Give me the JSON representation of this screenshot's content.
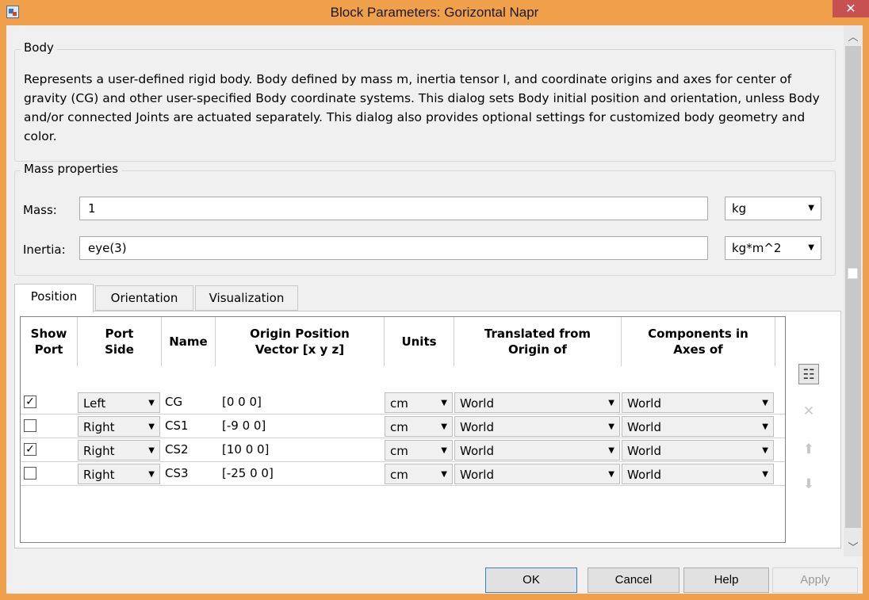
{
  "window": {
    "title": "Block Parameters: Gorizontal Napr",
    "close_glyph": "✕"
  },
  "body_group": {
    "legend": "Body",
    "description": "Represents a user-defined rigid body. Body defined by mass m, inertia tensor I, and coordinate origins and axes for center of gravity (CG) and other user-specified Body coordinate systems. This dialog sets Body initial position and orientation, unless Body and/or connected Joints are actuated separately. This dialog also provides optional settings for customized body geometry and color."
  },
  "mass_group": {
    "legend": "Mass properties",
    "mass_label": "Mass:",
    "mass_value": "1",
    "mass_unit": "kg",
    "inertia_label": "Inertia:",
    "inertia_value": "eye(3)",
    "inertia_unit": "kg*m^2"
  },
  "tabs": [
    {
      "label": "Position",
      "active": true
    },
    {
      "label": "Orientation",
      "active": false
    },
    {
      "label": "Visualization",
      "active": false
    }
  ],
  "table": {
    "headers": {
      "show_port": [
        "Show",
        "Port"
      ],
      "port_side": [
        "Port",
        "Side"
      ],
      "name": [
        "Name"
      ],
      "origin": [
        "Origin Position",
        "Vector [x y z]"
      ],
      "units": [
        "Units"
      ],
      "translated": [
        "Translated from",
        "Origin of"
      ],
      "components": [
        "Components in",
        "Axes of"
      ]
    },
    "rows": [
      {
        "show": true,
        "checkmark": "✓",
        "side": "Left",
        "name": "CG",
        "origin": "[0 0 0]",
        "units": "cm",
        "translated": "World",
        "components": "World"
      },
      {
        "show": false,
        "checkmark": "",
        "side": "Right",
        "name": "CS1",
        "origin": "[-9 0 0]",
        "units": "cm",
        "translated": "World",
        "components": "World"
      },
      {
        "show": true,
        "checkmark": "✓",
        "side": "Right",
        "name": "CS2",
        "origin": "[10 0 0]",
        "units": "cm",
        "translated": "World",
        "components": "World"
      },
      {
        "show": false,
        "checkmark": "",
        "side": "Right",
        "name": "CS3",
        "origin": "[-25 0 0]",
        "units": "cm",
        "translated": "World",
        "components": "World"
      }
    ]
  },
  "side_buttons": {
    "add": "☷",
    "delete": "✕",
    "up": "⬆",
    "down": "⬇"
  },
  "buttons": {
    "ok": "OK",
    "cancel": "Cancel",
    "help": "Help",
    "apply": "Apply"
  },
  "icons": {
    "dropdown": "▼",
    "scroll_up": "︿",
    "scroll_down": "﹀"
  },
  "colors": {
    "title_bar": "#f0a04b",
    "close": "#c75050",
    "client": "#f0f0f0"
  }
}
